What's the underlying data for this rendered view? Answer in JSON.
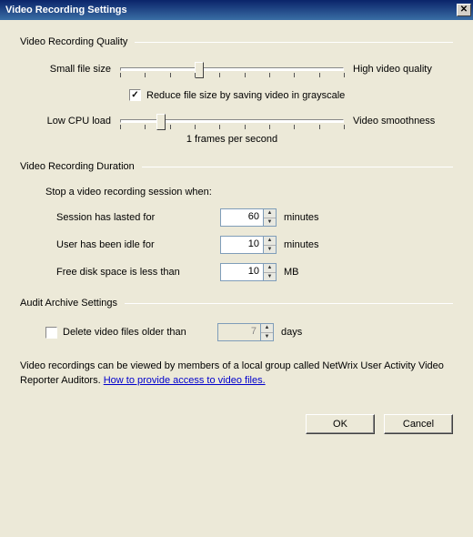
{
  "title": "Video Recording Settings",
  "sections": {
    "quality": {
      "header": "Video Recording Quality",
      "slider1_left": "Small file size",
      "slider1_right": "High video quality",
      "slider1_pos_pct": 33,
      "grayscale_checked": true,
      "grayscale_label": "Reduce file size by saving video in grayscale",
      "slider2_left": "Low CPU load",
      "slider2_right": "Video smoothness",
      "slider2_pos_pct": 16,
      "fps_label": "1 frames per second"
    },
    "duration": {
      "header": "Video Recording Duration",
      "intro": "Stop a video recording session when:",
      "rows": [
        {
          "label": "Session has lasted for",
          "value": "60",
          "unit": "minutes"
        },
        {
          "label": "User has been idle for",
          "value": "10",
          "unit": "minutes"
        },
        {
          "label": "Free disk space is less than",
          "value": "10",
          "unit": "MB"
        }
      ]
    },
    "archive": {
      "header": "Audit Archive Settings",
      "delete_checked": false,
      "delete_label": "Delete video files older than",
      "delete_value": "7",
      "delete_unit": "days"
    }
  },
  "note_prefix": "Video recordings can be viewed by members of a local group called NetWrix User Activity Video Reporter Auditors. ",
  "note_link": "How to provide access to video files.",
  "buttons": {
    "ok": "OK",
    "cancel": "Cancel"
  }
}
